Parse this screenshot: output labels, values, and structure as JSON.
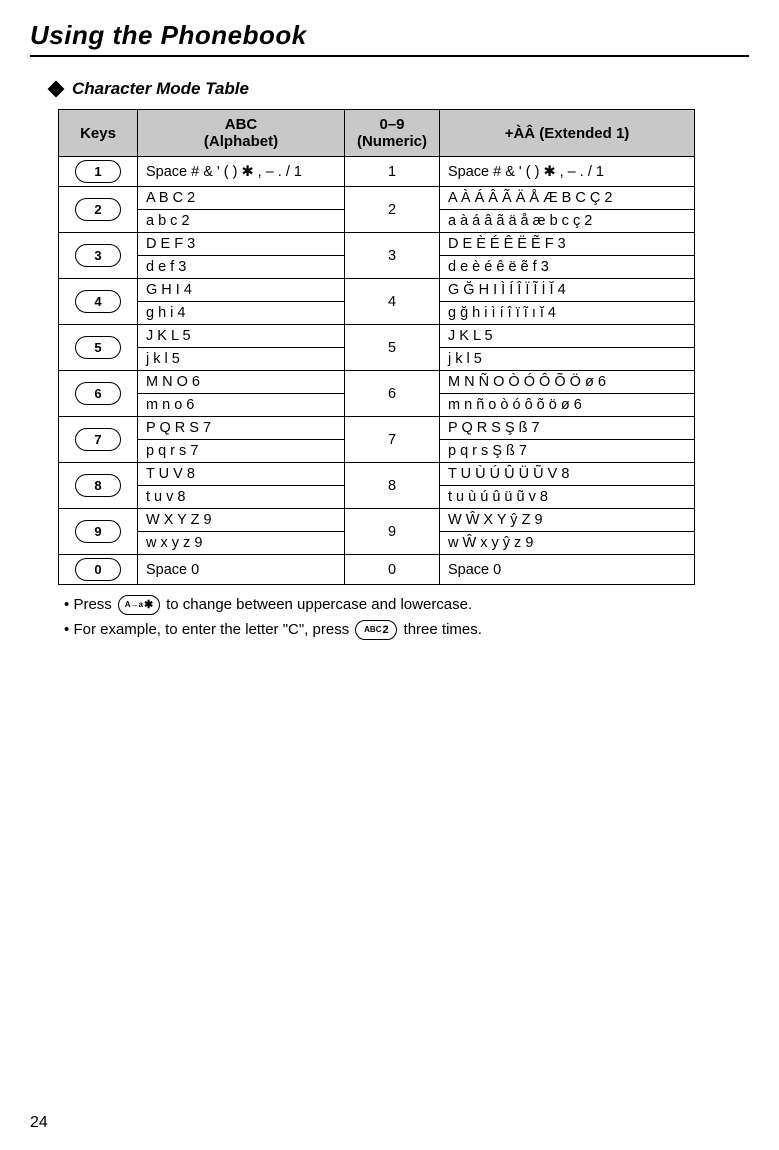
{
  "page_title": "Using the Phonebook",
  "section_heading": "Character Mode Table",
  "headers": {
    "keys": "Keys",
    "abc": "ABC\n(Alphabet)",
    "numeric": "0–9\n(Numeric)",
    "extended": "+ÀÂ (Extended 1)"
  },
  "rows": [
    {
      "key_label": "1",
      "abc_upper": "Space # & ' ( ) ✱ , – . / 1",
      "abc_lower": null,
      "numeric": "1",
      "ext_upper": "Space # & ' ( ) ✱ , – . / 1",
      "ext_lower": null
    },
    {
      "key_label": "2",
      "abc_upper": "A B C  2",
      "abc_lower": "a b c  2",
      "numeric": "2",
      "ext_upper": "A À Á Â Ã Ä Å Æ B C Ç 2",
      "ext_lower": "a à á â ã ä å æ b c ç 2"
    },
    {
      "key_label": "3",
      "abc_upper": "D E F  3",
      "abc_lower": "d e f  3",
      "numeric": "3",
      "ext_upper": "D E È É Ê Ë Ẽ F  3",
      "ext_lower": "d e è é ê ë ẽ f  3"
    },
    {
      "key_label": "4",
      "abc_upper": "G H I 4",
      "abc_lower": "g h i  4",
      "numeric": "4",
      "ext_upper": "G Ğ H I Ì Í Î Ï Ĩ İ Ĭ 4",
      "ext_lower": "g ğ h i ì í î ï ĩ ı ĭ 4"
    },
    {
      "key_label": "5",
      "abc_upper": "J K L  5",
      "abc_lower": "j k l 5",
      "numeric": "5",
      "ext_upper": "J K L  5",
      "ext_lower": "j k l 5"
    },
    {
      "key_label": "6",
      "abc_upper": "M N O 6",
      "abc_lower": "m n o 6",
      "numeric": "6",
      "ext_upper": "M N Ñ O Ò Ó Ô Õ Ö ø 6",
      "ext_lower": "m n ñ o ò ó ô õ ö ø 6"
    },
    {
      "key_label": "7",
      "abc_upper": "P Q R S 7",
      "abc_lower": "p q r s  7",
      "numeric": "7",
      "ext_upper": "P Q R S Ş ß 7",
      "ext_lower": "p q r s Ş ß 7"
    },
    {
      "key_label": "8",
      "abc_upper": "T U V 8",
      "abc_lower": "t u v  8",
      "numeric": "8",
      "ext_upper": "T U Ù Ú Û Ü Ũ V 8",
      "ext_lower": "t u ù ú û ü ũ v  8"
    },
    {
      "key_label": "9",
      "abc_upper": "W X Y Z 9",
      "abc_lower": "w x y z  9",
      "numeric": "9",
      "ext_upper": "W Ŵ X Y ŷ Z 9",
      "ext_lower": "w Ŵ x y ŷ z  9"
    },
    {
      "key_label": "0",
      "abc_upper": "Space  0",
      "abc_lower": null,
      "numeric": "0",
      "ext_upper": "Space  0",
      "ext_lower": null
    }
  ],
  "notes": {
    "bullet": "•",
    "n1_pre": "Press ",
    "n1_key_sup": "A→a",
    "n1_key": "✱",
    "n1_post": " to change between uppercase and lowercase.",
    "n2_pre": "For example, to enter the letter \"C\", press ",
    "n2_key_sup": "ABC",
    "n2_key": "2",
    "n2_post": " three times."
  },
  "page_number": "24"
}
